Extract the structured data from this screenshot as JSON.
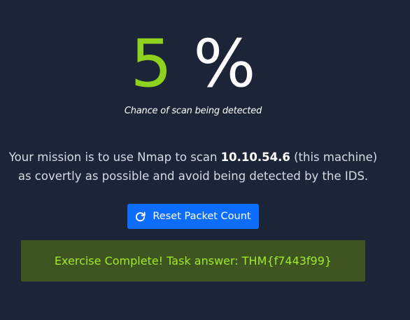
{
  "detection": {
    "value": "5",
    "unit": "%",
    "caption": "Chance of scan being detected"
  },
  "mission": {
    "line1_prefix": "Your mission is to use Nmap to scan ",
    "ip": "10.10.54.6",
    "line1_suffix": " (this machine)",
    "line2": "as covertly as possible and avoid being detected by the IDS."
  },
  "reset_button": {
    "label": "Reset Packet Count",
    "icon": "refresh-icon"
  },
  "result": {
    "text": "Exercise Complete! Task answer: THM{f7443f99}"
  },
  "colors": {
    "background": "#1c2538",
    "accent_green": "#8fd11f",
    "button_blue": "#0d6efd",
    "success_bg": "#3e5521",
    "success_text": "#a2ea28"
  }
}
